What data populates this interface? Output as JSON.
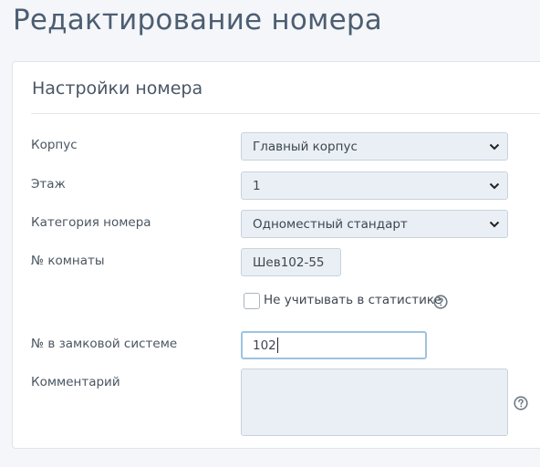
{
  "page_title": "Редактирование номера",
  "card_title": "Настройки номера",
  "fields": {
    "building": {
      "label": "Корпус",
      "value": "Главный корпус"
    },
    "floor": {
      "label": "Этаж",
      "value": "1"
    },
    "category": {
      "label": "Категория номера",
      "value": "Одноместный стандарт"
    },
    "room_number": {
      "label": "№ комнаты",
      "value": "Шев102-55"
    },
    "exclude_stats": {
      "label": "Не учитывать в статистике",
      "checked": false
    },
    "lock_system": {
      "label": "№ в замковой системе",
      "value": "102"
    },
    "comment": {
      "label": "Комментарий",
      "value": ""
    }
  },
  "icons": {
    "select_arrow": "chevron-down-icon",
    "help": "question-circle-icon"
  },
  "colors": {
    "title": "#4d5e72",
    "field_bg": "#eaeff6",
    "focus_border": "#9cc4e2",
    "help_icon": "#6f7a86"
  }
}
